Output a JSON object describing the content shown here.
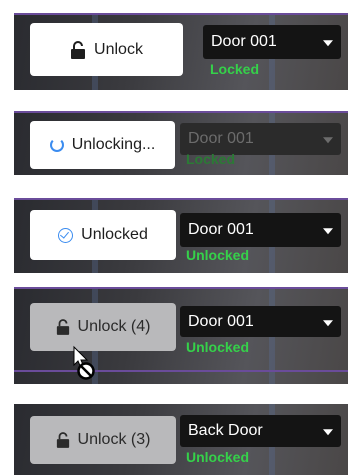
{
  "rows": [
    {
      "button_label": "Unlock",
      "door": "Door 001",
      "status": "Locked"
    },
    {
      "button_label": "Unlocking...",
      "door": "Door 001",
      "status": "Locked"
    },
    {
      "button_label": "Unlocked",
      "door": "Door 001",
      "status": "Unlocked"
    },
    {
      "button_label": "Unlock (4)",
      "door": "Door 001",
      "status": "Unlocked"
    },
    {
      "button_label": "Unlock (3)",
      "door": "Back Door",
      "status": "Unlocked"
    }
  ],
  "icons": {
    "unlock": "padlock-open-icon",
    "loading": "spinner-icon",
    "success": "check-circle-icon",
    "dropdown": "caret-down-icon",
    "cursor": "not-allowed-cursor-icon"
  },
  "colors": {
    "status_green": "#35d14a",
    "accent_blue": "#3b8cf0",
    "dropdown_bg": "#141414"
  }
}
